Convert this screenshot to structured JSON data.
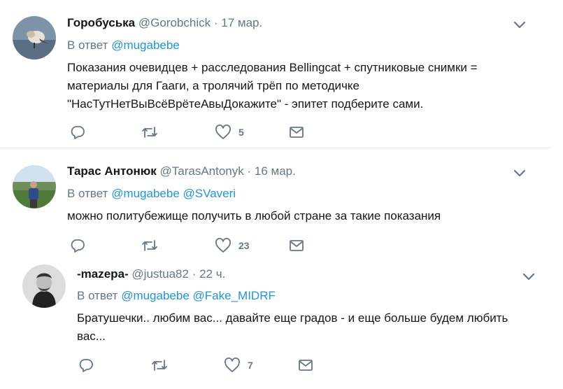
{
  "colors": {
    "accent": "#1b95e0",
    "muted": "#657786",
    "text": "#14171a",
    "border": "#e6ecf0"
  },
  "tweets": [
    {
      "name": "Горобуська",
      "handle": "@Gorobchick",
      "time": "17 мар.",
      "reply_prefix": "В ответ",
      "mentions": [
        "@mugabebe"
      ],
      "lines": [
        "Показания очевидцев + расследования Bellingcat + спутниковые снимки =",
        "материалы для Гааги, а тролячий трёп по методичке",
        "\"НасТутНетВыВсёВрётеАвыДокажите\" - эпитет подберите сами."
      ],
      "likes": "5"
    },
    {
      "name": "Тарас Антонюк",
      "handle": "@TarasAntonyk",
      "time": "16 мар.",
      "reply_prefix": "В ответ",
      "mentions": [
        "@mugabebe",
        "@SVaveri"
      ],
      "lines": [
        "можно политубежище получить в любой стране за такие показания"
      ],
      "likes": "23"
    },
    {
      "name": "-mazepa-",
      "handle": "@justua82",
      "time": "22 ч.",
      "reply_prefix": "В ответ",
      "mentions": [
        "@mugabebe",
        "@Fake_MIDRF"
      ],
      "lines": [
        "Братушечки.. любим вас... давайте еще градов - и еще больше будем любить",
        "вас..."
      ],
      "likes": "7"
    }
  ],
  "icons": {
    "reply": "reply-icon",
    "retweet": "retweet-icon",
    "like": "heart-icon",
    "dm": "envelope-icon",
    "more": "chevron-down-icon"
  }
}
